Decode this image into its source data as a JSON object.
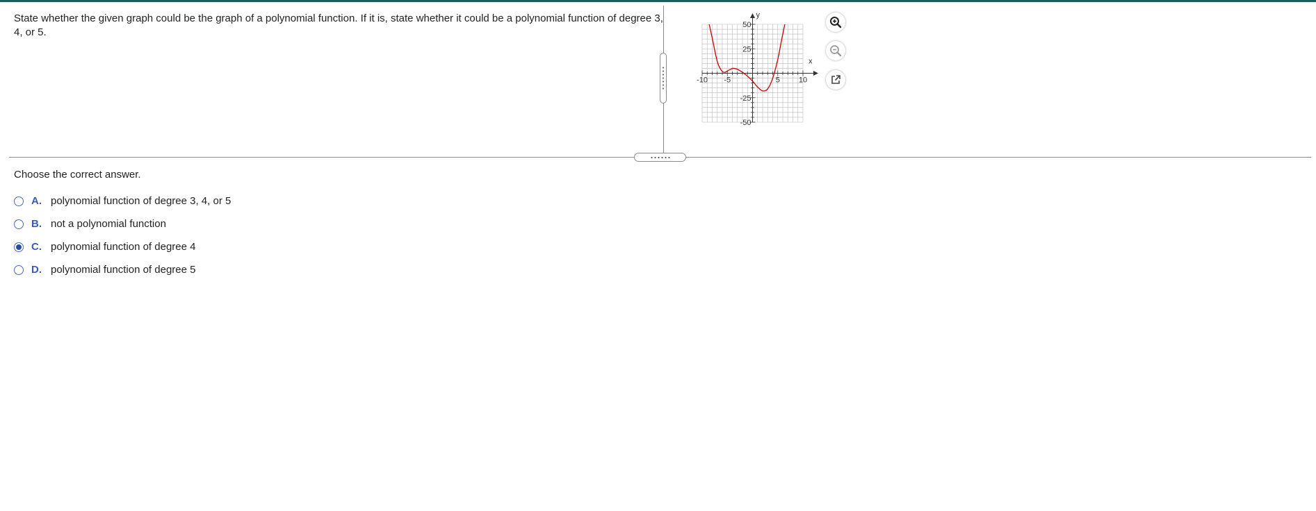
{
  "question": {
    "text": "State whether the given graph could be the graph of a polynomial function. If it is, state whether it could be a polynomial function of degree 3, 4, or 5."
  },
  "graph": {
    "x_axis_label": "x",
    "y_axis_label": "y",
    "x_tick_labels": [
      "-10",
      "-5",
      "5",
      "10"
    ],
    "y_tick_labels": [
      "50",
      "25",
      "-25",
      "-50"
    ],
    "xlim": [
      -10,
      10
    ],
    "ylim": [
      -50,
      50
    ],
    "grid": true,
    "curve_color": "#cc0000",
    "curve_points": [
      [
        -8.6,
        50
      ],
      [
        -8.0,
        36
      ],
      [
        -7.0,
        12
      ],
      [
        -6.2,
        3
      ],
      [
        -5.5,
        1
      ],
      [
        -4.6,
        3.5
      ],
      [
        -3.8,
        5
      ],
      [
        -3.0,
        4
      ],
      [
        -2.0,
        1
      ],
      [
        -1.0,
        -3
      ],
      [
        0,
        -8
      ],
      [
        1.0,
        -14
      ],
      [
        2.0,
        -18
      ],
      [
        3.0,
        -16
      ],
      [
        4.0,
        -5
      ],
      [
        5.0,
        14
      ],
      [
        5.8,
        35
      ],
      [
        6.4,
        50
      ]
    ]
  },
  "tools": {
    "zoom_in_icon": "zoom-in-icon",
    "zoom_out_icon": "zoom-out-icon",
    "popout_icon": "popout-icon"
  },
  "prompt": "Choose the correct answer.",
  "answers": [
    {
      "letter": "A.",
      "text": "polynomial function of degree 3, 4, or 5",
      "selected": false
    },
    {
      "letter": "B.",
      "text": "not a polynomial function",
      "selected": false
    },
    {
      "letter": "C.",
      "text": "polynomial function of degree 4",
      "selected": true
    },
    {
      "letter": "D.",
      "text": "polynomial function of degree 5",
      "selected": false
    }
  ],
  "colors": {
    "top_bar": "#1d5e5a",
    "answer_letter": "#3b5ab0",
    "radio_selected": "#2c4a9c"
  }
}
